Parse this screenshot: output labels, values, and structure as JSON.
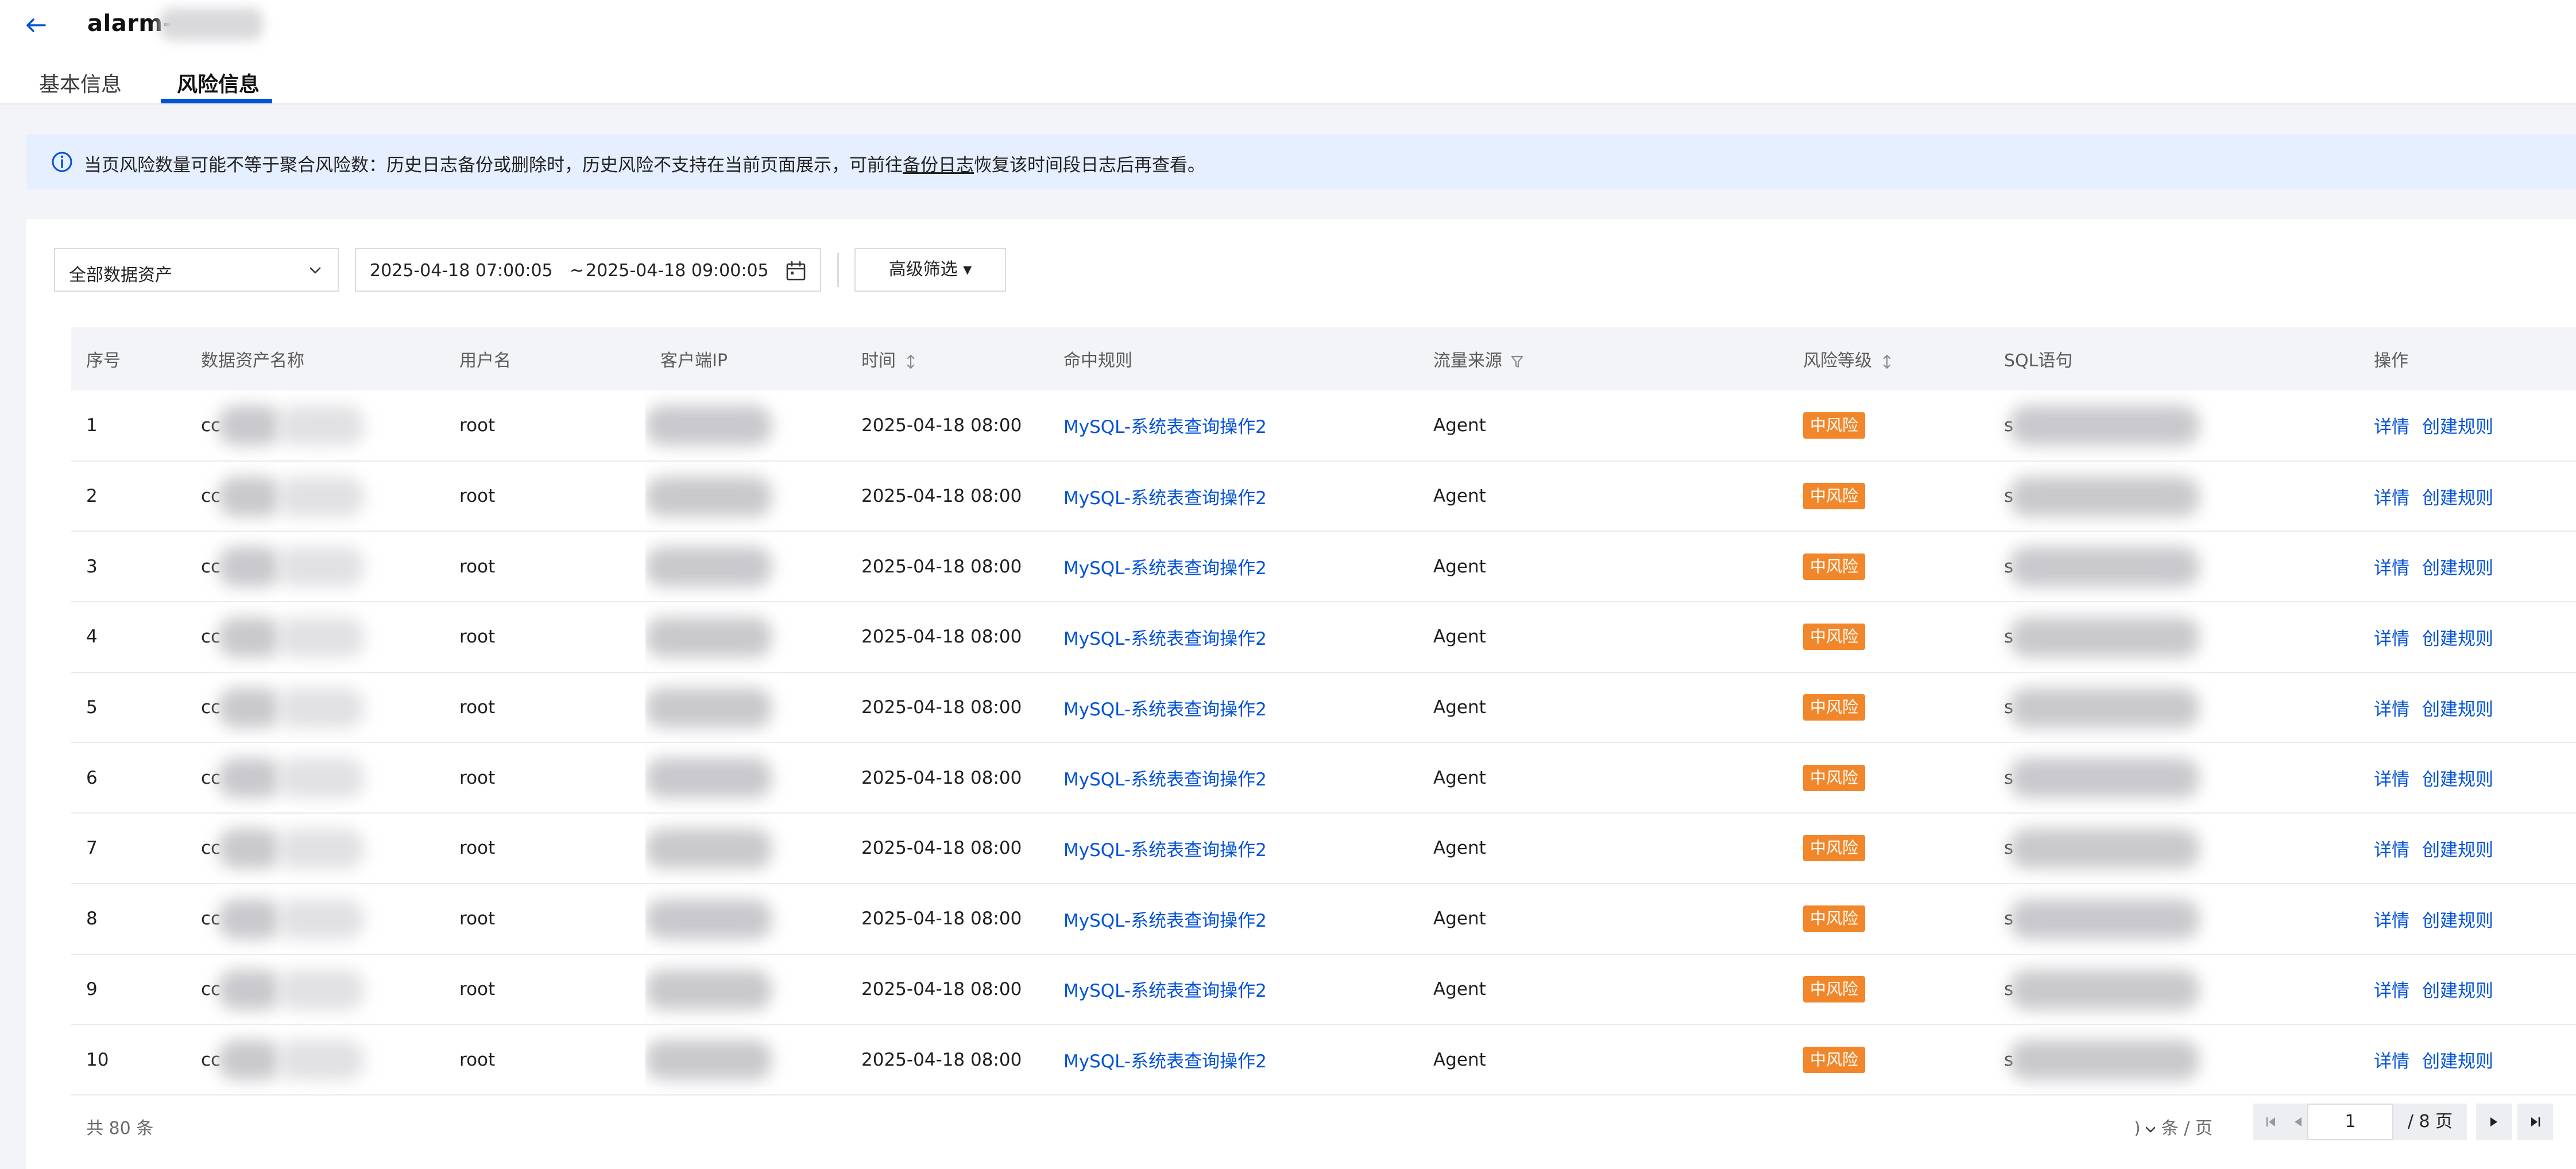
{
  "header": {
    "title": "alarm-",
    "tabs": [
      {
        "label": "基本信息",
        "active": false
      },
      {
        "label": "风险信息",
        "active": true
      }
    ]
  },
  "notice": {
    "text_before": "当页风险数量可能不等于聚合风险数：历史日志备份或删除时，历史风险不支持在当前页面展示，可前往",
    "link": "备份日志",
    "text_after": "恢复该时间段日志后再查看。"
  },
  "filters": {
    "asset_select": "全部数据资产",
    "date_start": "2025-04-18 07:00:05",
    "date_sep": "~",
    "date_end": "2025-04-18 09:00:05",
    "advanced": "高级筛选 ▾"
  },
  "table": {
    "columns": [
      "序号",
      "数据资产名称",
      "用户名",
      "客户端IP",
      "时间",
      "命中规则",
      "流量来源",
      "风险等级",
      "SQL语句",
      "操作"
    ],
    "rows": [
      {
        "idx": "1",
        "asset": "cc",
        "user": "root",
        "time": "2025-04-18 08:00",
        "rule": "MySQL-系统表查询操作2",
        "source": "Agent",
        "risk": "中风险",
        "sql": "s",
        "op_detail": "详情",
        "op_create": "创建规则"
      },
      {
        "idx": "2",
        "asset": "cc",
        "user": "root",
        "time": "2025-04-18 08:00",
        "rule": "MySQL-系统表查询操作2",
        "source": "Agent",
        "risk": "中风险",
        "sql": "s",
        "op_detail": "详情",
        "op_create": "创建规则"
      },
      {
        "idx": "3",
        "asset": "cc",
        "user": "root",
        "time": "2025-04-18 08:00",
        "rule": "MySQL-系统表查询操作2",
        "source": "Agent",
        "risk": "中风险",
        "sql": "s",
        "op_detail": "详情",
        "op_create": "创建规则"
      },
      {
        "idx": "4",
        "asset": "cc",
        "user": "root",
        "time": "2025-04-18 08:00",
        "rule": "MySQL-系统表查询操作2",
        "source": "Agent",
        "risk": "中风险",
        "sql": "s",
        "op_detail": "详情",
        "op_create": "创建规则"
      },
      {
        "idx": "5",
        "asset": "cc",
        "user": "root",
        "time": "2025-04-18 08:00",
        "rule": "MySQL-系统表查询操作2",
        "source": "Agent",
        "risk": "中风险",
        "sql": "s",
        "op_detail": "详情",
        "op_create": "创建规则"
      },
      {
        "idx": "6",
        "asset": "cc",
        "user": "root",
        "time": "2025-04-18 08:00",
        "rule": "MySQL-系统表查询操作2",
        "source": "Agent",
        "risk": "中风险",
        "sql": "s",
        "op_detail": "详情",
        "op_create": "创建规则"
      },
      {
        "idx": "7",
        "asset": "cc",
        "user": "root",
        "time": "2025-04-18 08:00",
        "rule": "MySQL-系统表查询操作2",
        "source": "Agent",
        "risk": "中风险",
        "sql": "s",
        "op_detail": "详情",
        "op_create": "创建规则"
      },
      {
        "idx": "8",
        "asset": "cc",
        "user": "root",
        "time": "2025-04-18 08:00",
        "rule": "MySQL-系统表查询操作2",
        "source": "Agent",
        "risk": "中风险",
        "sql": "s",
        "op_detail": "详情",
        "op_create": "创建规则"
      },
      {
        "idx": "9",
        "asset": "cc",
        "user": "root",
        "time": "2025-04-18 08:00",
        "rule": "MySQL-系统表查询操作2",
        "source": "Agent",
        "risk": "中风险",
        "sql": "s",
        "op_detail": "详情",
        "op_create": "创建规则"
      },
      {
        "idx": "10",
        "asset": "cc",
        "user": "root",
        "time": "2025-04-18 08:00",
        "rule": "MySQL-系统表查询操作2",
        "source": "Agent",
        "risk": "中风险",
        "sql": "s",
        "op_detail": "详情",
        "op_create": "创建规则"
      }
    ]
  },
  "footer": {
    "total": "共 80 条",
    "page_size_value": ")",
    "page_size_unit": "条 / 页",
    "current_page": "1",
    "total_pages": "/ 8 页"
  },
  "colors": {
    "accent": "#0052d9",
    "risk_medium": "#f1872a",
    "notice_bg": "#e6efff"
  },
  "icons": [
    "back-arrow-icon",
    "info-icon",
    "chevron-down-icon",
    "calendar-icon",
    "sort-icon",
    "filter-icon",
    "first-page-icon",
    "prev-page-icon",
    "next-page-icon",
    "last-page-icon"
  ]
}
